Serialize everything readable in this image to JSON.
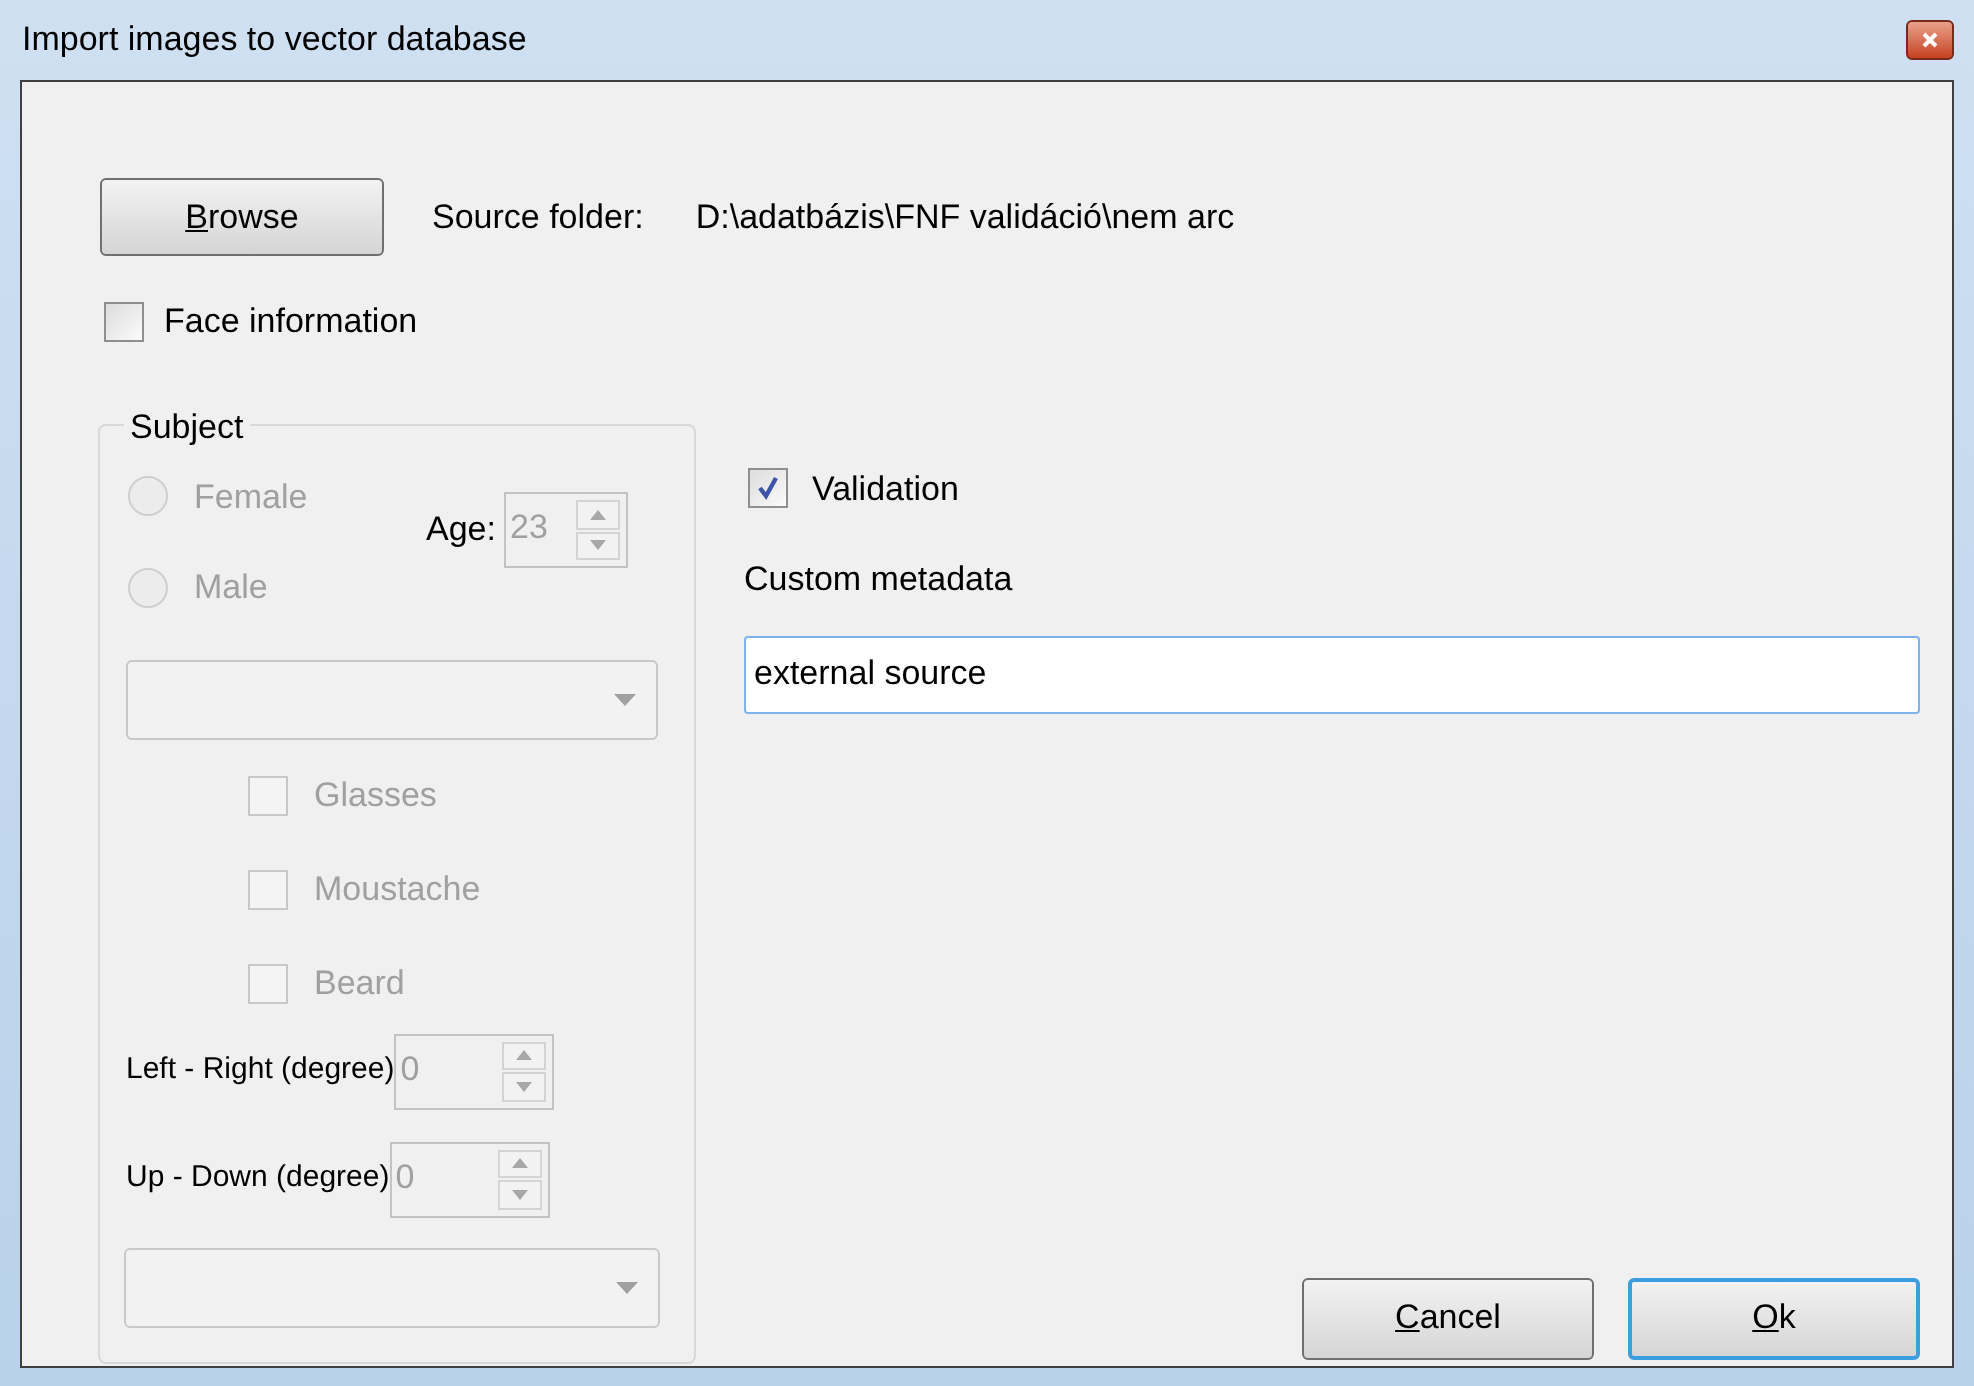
{
  "window": {
    "title": "Import images to vector database"
  },
  "browse_button": {
    "label": "Browse"
  },
  "source_folder": {
    "label": "Source folder:",
    "path": "D:\\adatbázis\\FNF validáció\\nem arc"
  },
  "face_information": {
    "label": "Face information",
    "checked": false
  },
  "subject": {
    "legend": "Subject",
    "disabled": true,
    "gender": [
      {
        "label": "Female",
        "selected": false
      },
      {
        "label": "Male",
        "selected": false
      }
    ],
    "age": {
      "label": "Age:",
      "value": "23"
    },
    "traits": [
      {
        "label": "Glasses",
        "checked": false
      },
      {
        "label": "Moustache",
        "checked": false
      },
      {
        "label": "Beard",
        "checked": false
      }
    ],
    "left_right": {
      "label": "Left - Right (degree)",
      "value": "0"
    },
    "up_down": {
      "label": "Up - Down (degree)",
      "value": "0"
    }
  },
  "validation": {
    "label": "Validation",
    "checked": true
  },
  "custom_metadata": {
    "label": "Custom metadata",
    "value": "external source"
  },
  "buttons": [
    {
      "label": "Cancel",
      "default": false
    },
    {
      "label": "Ok",
      "default": true
    }
  ]
}
